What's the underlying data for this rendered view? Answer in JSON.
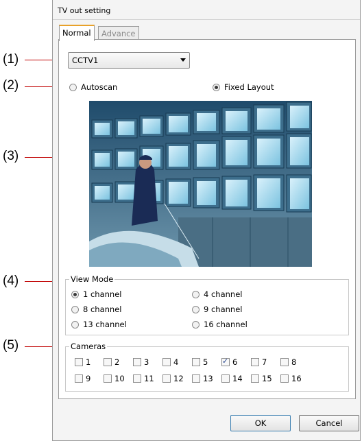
{
  "callouts": [
    "(1)",
    "(2)",
    "(3)",
    "(4)",
    "(5)"
  ],
  "window": {
    "title": "TV out setting"
  },
  "tabs": [
    "Normal",
    "Advance"
  ],
  "output": {
    "selected": "CCTV1"
  },
  "display": {
    "autoscan": "Autoscan",
    "fixed_layout": "Fixed Layout",
    "selected": "Fixed Layout"
  },
  "view_mode": {
    "title": "View Mode",
    "options": [
      "1 channel",
      "4 channel",
      "8 channel",
      "9 channel",
      "13 channel",
      "16 channel"
    ],
    "selected": "1 channel"
  },
  "cameras": {
    "title": "Cameras",
    "labels": [
      "1",
      "2",
      "3",
      "4",
      "5",
      "6",
      "7",
      "8",
      "9",
      "10",
      "11",
      "12",
      "13",
      "14",
      "15",
      "16"
    ],
    "checked": [
      "6"
    ]
  },
  "buttons": {
    "ok": "OK",
    "cancel": "Cancel"
  },
  "colors": {
    "leader": "#c00000",
    "tab_accent": "#e8a12a",
    "preview_bg": "#2b5a7a"
  }
}
